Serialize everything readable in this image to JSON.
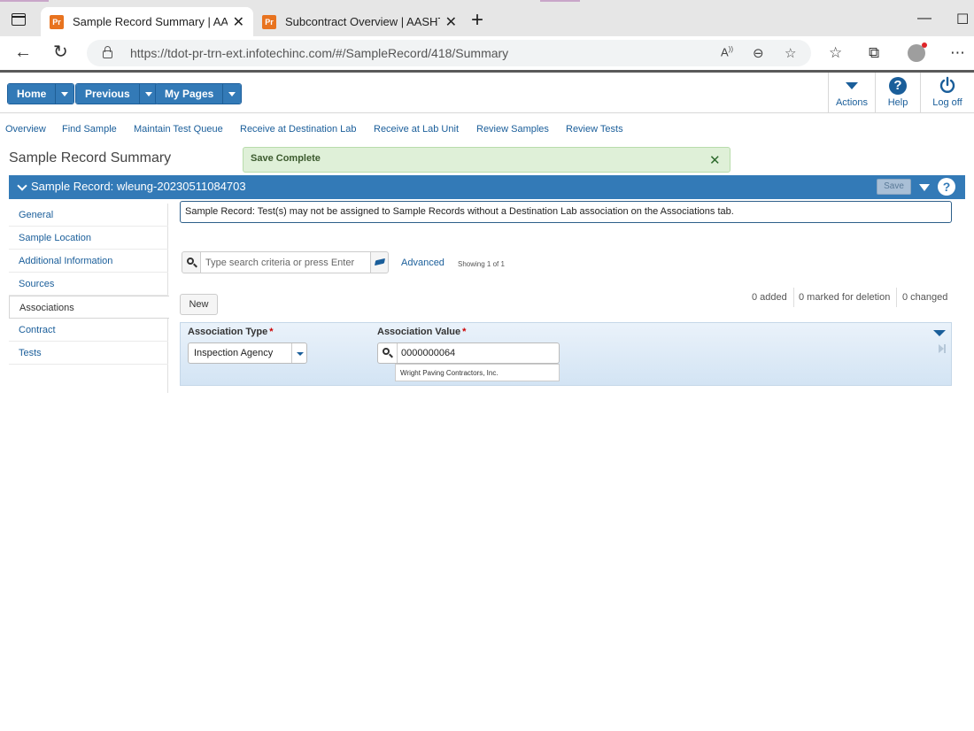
{
  "browser": {
    "tabs": [
      {
        "favicon": "Pr",
        "title": "Sample Record Summary | AASHTOWare Project",
        "active": true
      },
      {
        "favicon": "Pr",
        "title": "Subcontract Overview | AASHTOWare Project",
        "active": false
      }
    ],
    "url": "https://tdot-pr-trn-ext.infotechinc.com/#/SampleRecord/418/Summary",
    "icons": [
      "tab-actions-icon",
      "back-icon",
      "refresh-icon",
      "lock-icon",
      "read-aloud-icon",
      "zoom-out-icon",
      "add-favorite-icon",
      "favorites-icon",
      "collections-icon",
      "profile-icon",
      "more-icon"
    ]
  },
  "header": {
    "home": "Home",
    "previous": "Previous",
    "my_pages": "My Pages",
    "actions": "Actions",
    "help": "Help",
    "logoff": "Log off"
  },
  "subnav": [
    "Overview",
    "Find Sample",
    "Maintain Test Queue",
    "Receive at Destination Lab",
    "Receive at Lab Unit",
    "Review Samples",
    "Review Tests"
  ],
  "page": {
    "title": "Sample Record Summary",
    "toast": "Save Complete"
  },
  "section": {
    "title": "Sample Record: wleung-20230511084703",
    "save": "Save"
  },
  "leftnav": [
    "General",
    "Sample Location",
    "Additional Information",
    "Sources",
    "Associations",
    "Contract",
    "Tests"
  ],
  "info": "Sample Record: Test(s) may not be assigned to Sample Records without a Destination Lab association on the Associations tab.",
  "search": {
    "placeholder": "Type search criteria or press Enter",
    "advanced": "Advanced",
    "showing": "Showing 1 of 1"
  },
  "grid": {
    "new": "New",
    "added": "0 added",
    "marked": "0 marked for deletion",
    "changed": "0 changed",
    "assoc_type_label": "Association Type",
    "assoc_value_label": "Association Value",
    "required_mark": "*",
    "assoc_type": "Inspection Agency",
    "assoc_value": "0000000064",
    "assoc_desc": "Wright Paving Contractors, Inc."
  },
  "colors": {
    "accent": "#337ab7",
    "link": "#1a5e9a",
    "success_bg": "#dff0d8",
    "required": "#cc0000"
  }
}
